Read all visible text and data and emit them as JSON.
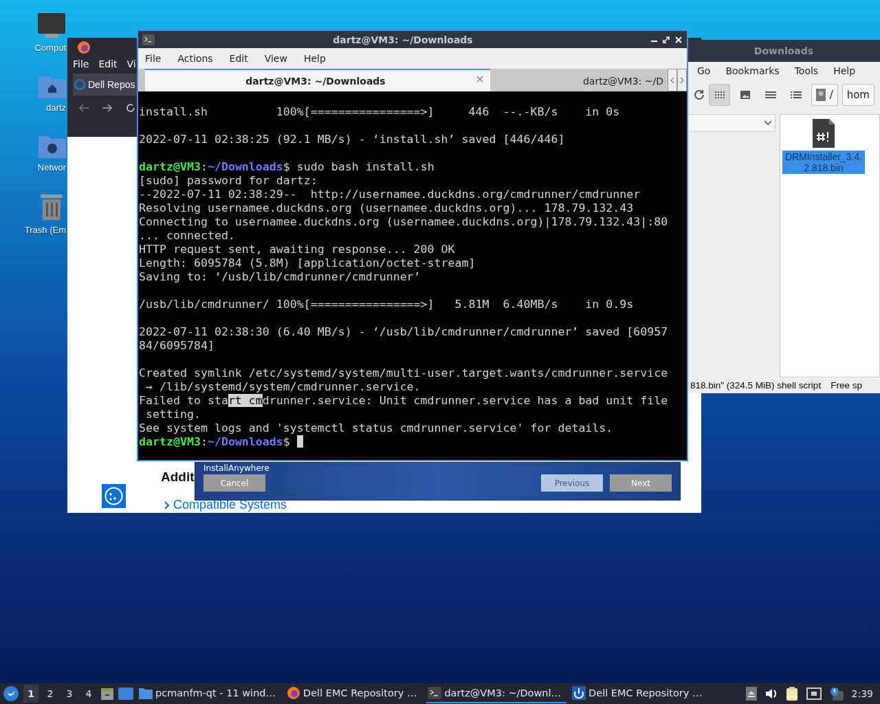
{
  "desktop_icons": [
    {
      "kind": "computer",
      "label": "Comput"
    },
    {
      "kind": "home",
      "label": "dartz"
    },
    {
      "kind": "network",
      "label": "Networ"
    },
    {
      "kind": "trash",
      "label": "Trash (Em"
    }
  ],
  "browser": {
    "menu": [
      "File",
      "Edit",
      "Vi"
    ],
    "tab": "Dell Repos",
    "heading": "Addit",
    "link": "Compatible Systems"
  },
  "file_manager": {
    "title": "Downloads",
    "menu": [
      "Go",
      "Bookmarks",
      "Tools",
      "Help"
    ],
    "view_modes": [
      {
        "kind": "icons",
        "selected": true
      },
      {
        "kind": "thumbnails",
        "selected": false
      },
      {
        "kind": "compact",
        "selected": false
      },
      {
        "kind": "details",
        "selected": false
      }
    ],
    "path": [
      "/",
      "hom"
    ],
    "files": [
      {
        "name": "DRMInstaller_3.4.2.818.bin",
        "selected": true
      }
    ],
    "status": "818.bin\" (324.5 MiB) shell script",
    "free_space": "Free sp"
  },
  "installer": {
    "title": "InstallAnywhere",
    "buttons": [
      {
        "label": "Cancel",
        "disabled": false
      },
      {
        "label": "Previous",
        "disabled": true
      },
      {
        "label": "Next",
        "disabled": false
      }
    ]
  },
  "terminal": {
    "title": "dartz@VM3: ~/Downloads",
    "menu": [
      "File",
      "Actions",
      "Edit",
      "View",
      "Help"
    ],
    "tabs": [
      {
        "label": "dartz@VM3: ~/Downloads",
        "selected": true
      },
      {
        "label": "dartz@VM3: ~/D",
        "selected": false
      }
    ],
    "blocks": [
      [
        {
          "kind": "output",
          "text": "install.sh          100%[================>]     446  --.-KB/s    in 0s"
        }
      ],
      [
        {
          "kind": "output",
          "text": "2022-07-11 02:38:25 (92.1 MB/s) - ‘install.sh’ saved [446/446]"
        }
      ],
      [
        {
          "kind": "prompt",
          "user": "dartz@VM3",
          "separator": ":",
          "path": "~/Downloads",
          "symbol": "$",
          "command": "sudo bash install.sh",
          "cursor": false
        },
        {
          "kind": "output",
          "text": "[sudo] password for dartz:"
        },
        {
          "kind": "output",
          "text": "--2022-07-11 02:38:29--  http://usernamee.duckdns.org/cmdrunner/cmdrunner"
        },
        {
          "kind": "output",
          "text": "Resolving usernamee.duckdns.org (usernamee.duckdns.org)... 178.79.132.43"
        },
        {
          "kind": "output",
          "text": "Connecting to usernamee.duckdns.org (usernamee.duckdns.org)|178.79.132.43|:80"
        },
        {
          "kind": "output",
          "text": "... connected."
        },
        {
          "kind": "output",
          "text": "HTTP request sent, awaiting response... 200 OK"
        },
        {
          "kind": "output",
          "text": "Length: 6095784 (5.8M) [application/octet-stream]"
        },
        {
          "kind": "output",
          "text": "Saving to: ‘/usb/lib/cmdrunner/cmdrunner’"
        }
      ],
      [
        {
          "kind": "output",
          "text": "/usb/lib/cmdrunner/ 100%[================>]   5.81M  6.40MB/s    in 0.9s"
        }
      ],
      [
        {
          "kind": "output",
          "text": "2022-07-11 02:38:30 (6.40 MB/s) - ‘/usb/lib/cmdrunner/cmdrunner’ saved [60957"
        },
        {
          "kind": "output",
          "text": "84/6095784]"
        }
      ],
      [
        {
          "kind": "output",
          "text": "Created symlink /etc/systemd/system/multi-user.target.wants/cmdrunner.service"
        },
        {
          "kind": "output",
          "text": " → /lib/systemd/system/cmdrunner.service."
        },
        {
          "kind": "selection",
          "before": "Failed to sta",
          "selected": "rt cm",
          "after": "drunner.service: Unit cmdrunner.service has a bad unit file"
        },
        {
          "kind": "output",
          "text": " setting."
        },
        {
          "kind": "output",
          "text": "See system logs and 'systemctl status cmdrunner.service' for details."
        },
        {
          "kind": "prompt",
          "user": "dartz@VM3",
          "separator": ":",
          "path": "~/Downloads",
          "symbol": "$",
          "cursor": true
        }
      ]
    ]
  },
  "taskbar": {
    "workspaces": [
      {
        "label": "1",
        "selected": true
      },
      {
        "label": "2",
        "selected": false
      },
      {
        "label": "3",
        "selected": false
      },
      {
        "label": "4",
        "selected": false
      }
    ],
    "tasks": [
      {
        "kind": "folder",
        "label": "pcmanfm-qt - 11 wind…",
        "selected": false
      },
      {
        "kind": "browser",
        "label": "Dell EMC Repository …",
        "selected": false
      },
      {
        "kind": "terminal",
        "label": "dartz@VM3: ~/Downl…",
        "selected": true
      },
      {
        "kind": "installer",
        "label": "Dell EMC Repository …",
        "selected": false
      }
    ],
    "clock": "2:39"
  }
}
